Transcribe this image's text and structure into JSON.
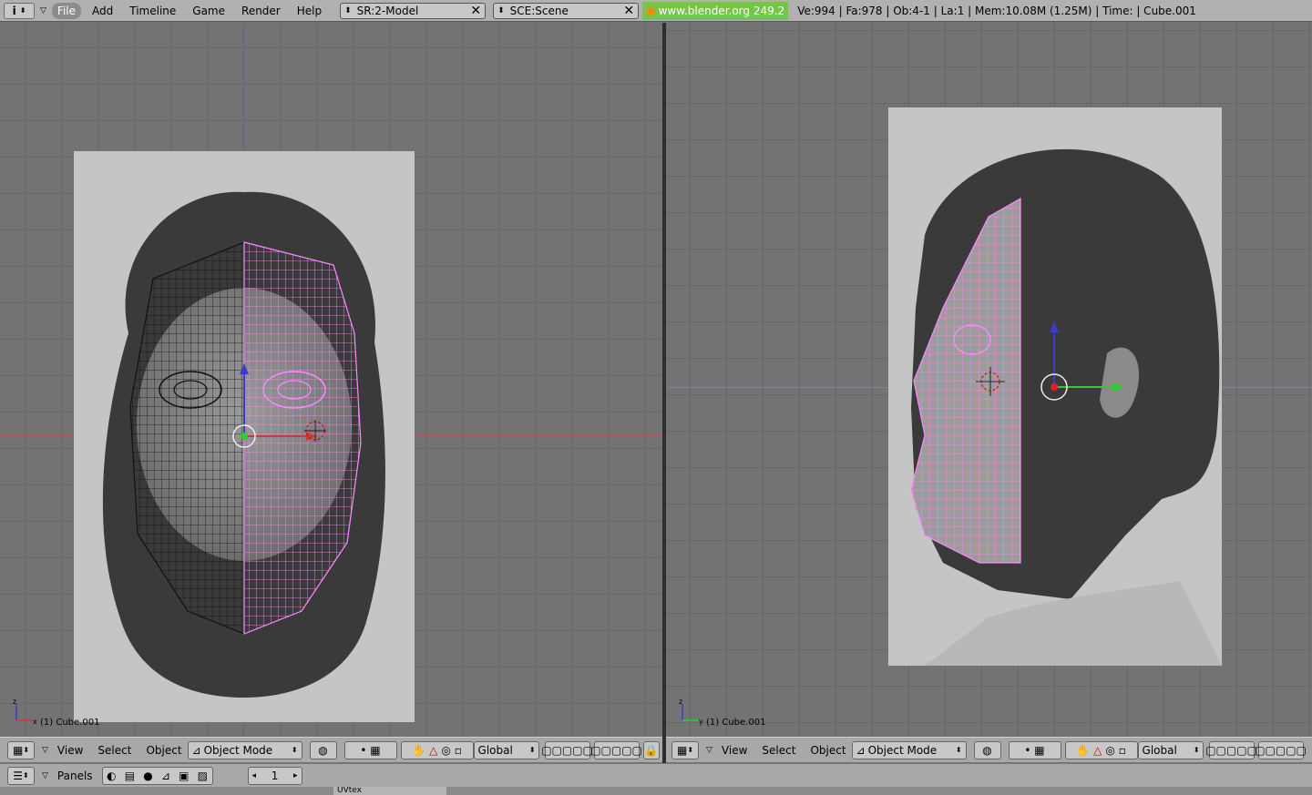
{
  "topbar": {
    "info_icon": "info-icon",
    "menus": [
      "File",
      "Add",
      "Timeline",
      "Game",
      "Render",
      "Help"
    ],
    "screen_field": "SR:2-Model",
    "scene_field": "SCE:Scene",
    "url": "www.blender.org 249.2",
    "stats": "Ve:994 | Fa:978 | Ob:4-1 | La:1  | Mem:10.08M (1.25M)  | Time: | Cube.001"
  },
  "viewports": {
    "left": {
      "object_label": "(1) Cube.001"
    },
    "right": {
      "object_label": "(1) Cube.001"
    }
  },
  "view3d_header": {
    "menus": [
      "View",
      "Select",
      "Object"
    ],
    "mode": "Object Mode",
    "orientation": "Global"
  },
  "buttons_header": {
    "panels_label": "Panels",
    "frame": "1",
    "strip_tab": "UVtex"
  },
  "colors": {
    "mesh_selected": "#ff88ff",
    "mesh_unselected": "#111111",
    "axis_x": "#cc3b3b",
    "axis_y": "#3bcc3b",
    "axis_z": "#3b3bcc",
    "url_bg": "#74c54a"
  }
}
